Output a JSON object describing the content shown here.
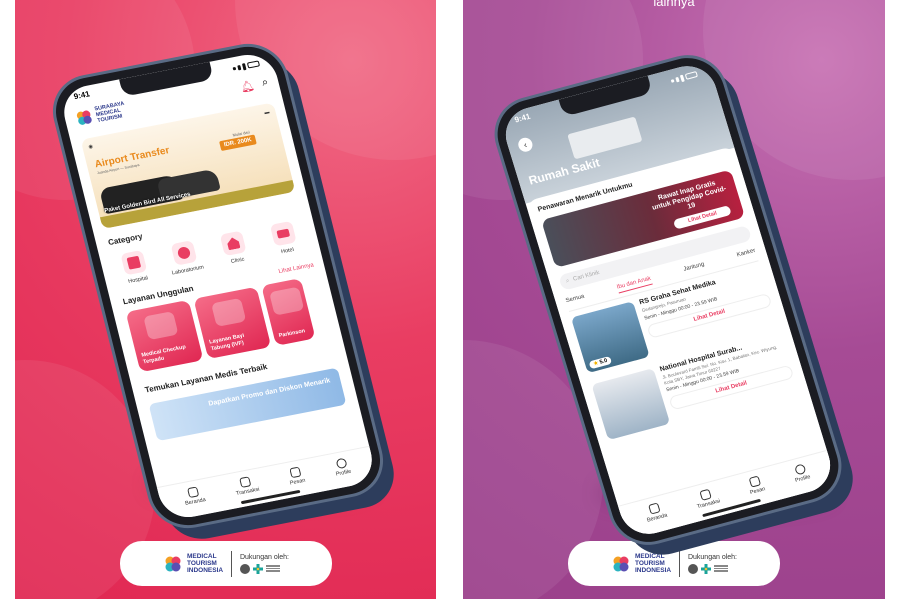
{
  "right_panel": {
    "caption": "lainnya"
  },
  "footer": {
    "brand_line1": "MEDICAL",
    "brand_line2": "TOURISM",
    "brand_line3": "INDONESIA",
    "supported_label": "Dukungan oleh:"
  },
  "phone1": {
    "status_time": "9:41",
    "brand_line1": "SURABAYA",
    "brand_line2": "MEDICAL",
    "brand_line3": "TOURISM",
    "promo": {
      "title": "Airport Transfer",
      "subtitle": "Juanda Airport — Surabaya",
      "price_label": "Mulai dari",
      "price": "IDR. 200K",
      "caption": "Paket Golden Bird All Services"
    },
    "category_title": "Category",
    "categories": [
      "Hospital",
      "Laboratorium",
      "Clinic",
      "Hotel"
    ],
    "services_title": "Layanan Unggulan",
    "services_link": "Lihat Lainnya",
    "services": [
      "Medical Checkup Terpadu",
      "Layanan Bayi Tabung (IVF)",
      "Parkinson"
    ],
    "find_title": "Temukan Layanan Medis Terbaik",
    "banner_text": "Dapatkan Promo dan Diskon Menarik",
    "tabs": [
      "Beranda",
      "Transaksi",
      "Pesan",
      "Profile"
    ]
  },
  "phone2": {
    "status_time": "9:41",
    "title": "Rumah Sakit",
    "offer_title": "Penawaran Menarik Untukmu",
    "offer_text": "Rawat Inap Gratis untuk Pengidap Covid-19",
    "offer_button": "Lihat Detail",
    "search_placeholder": "Cari Klinik",
    "filters": [
      "Semua",
      "Ibu dan Anak",
      "Jantung",
      "Kanker"
    ],
    "hospitals": [
      {
        "name": "RS Graha Sehat Medika",
        "address": "Gedangrejo, Pasuruan",
        "hours": "Senin - Minggu 00:00 - 23.59 WIB",
        "rating": "5.0",
        "button": "Lihat Detail"
      },
      {
        "name": "National Hospital Surab...",
        "address": "Jl. Boulevard Famili Sel. No. Kav. 1, Babatan, Kec. Wiyung, Kota SBY, Jawa Timur 60227",
        "hours": "Senin - Minggu 00:00 - 23.59 WIB",
        "rating": "",
        "button": "Lihat Detail"
      }
    ],
    "tabs": [
      "Beranda",
      "Transaksi",
      "Pesan",
      "Profile"
    ]
  },
  "colors": {
    "left_bg": "#e93d62",
    "right_bg": "#a64b95",
    "accent": "#e93d62",
    "brand_navy": "#2d3a8c"
  }
}
